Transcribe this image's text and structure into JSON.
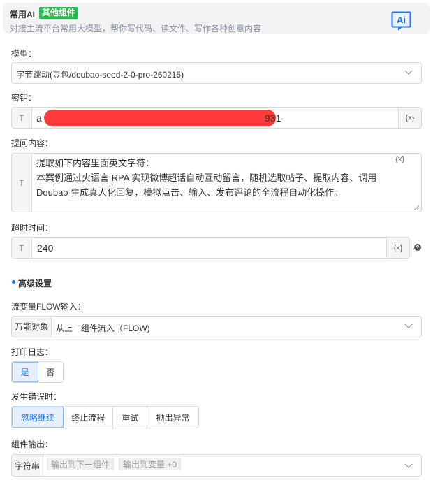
{
  "header": {
    "title": "常用AI",
    "tag": "其他组件",
    "description": "对接主流平台常用大模型，帮你写代码、读文件、写作各种创意内容",
    "icon": "ai-logo-icon",
    "icon_text": "Ai"
  },
  "model": {
    "label": "模型：",
    "value": "字节跳动(豆包/doubao-seed-2-0-pro-260215)"
  },
  "secret": {
    "label": "密钥：",
    "type_prefix": "T",
    "value_start": "a",
    "value_end": "931",
    "var_button": "{x}"
  },
  "prompt": {
    "label": "提问内容：",
    "type_prefix": "T",
    "line1": "提取如下内容里面英文字符：",
    "line2": "本案例通过火语言 RPA 实现微博超话自动互动留言，随机选取帖子、提取内容、调用",
    "line3": "Doubao 生成真人化回复，模拟点击、输入、发布评论的全流程自动化操作。",
    "var_button": "{x}"
  },
  "timeout": {
    "label": "超时时间：",
    "type_prefix": "T",
    "value": "240",
    "var_button": "{x}",
    "help": "?"
  },
  "advanced": {
    "title": "高级设置"
  },
  "flow_input": {
    "label": "流变量FLOW输入：",
    "prefix": "万能对象",
    "value": "从上一组件流入（FLOW)"
  },
  "print_log": {
    "label": "打印日志：",
    "options": [
      "是",
      "否"
    ],
    "selected": 0
  },
  "on_error": {
    "label": "发生错误时：",
    "options": [
      "忽略继续",
      "终止流程",
      "重试",
      "抛出异常"
    ],
    "selected": 0
  },
  "output": {
    "label": "组件输出：",
    "prefix": "字符串",
    "chips": [
      "输出到下一组件",
      "输出到变量 +0"
    ]
  },
  "colors": {
    "accent": "#1677ff",
    "tag_green": "#2db84d",
    "redaction": "#ff3b3b"
  }
}
